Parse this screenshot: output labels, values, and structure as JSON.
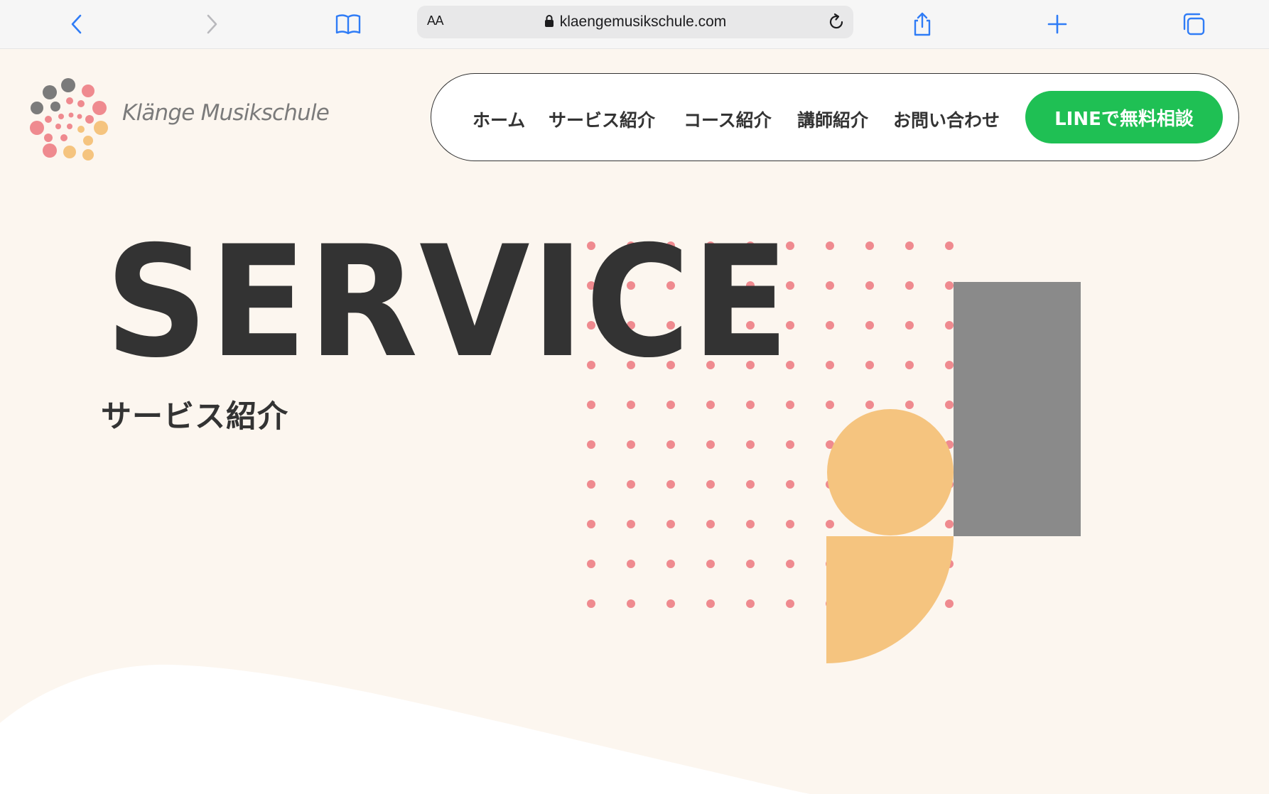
{
  "browser": {
    "reader_label": "AA",
    "url": "klaengemusikschule.com",
    "icons": [
      "back-chevron-icon",
      "forward-chevron-icon",
      "bookmarks-book-icon",
      "lock-icon",
      "reload-icon",
      "share-icon",
      "plus-icon",
      "tabs-icon"
    ]
  },
  "site": {
    "logo_text": "Klänge Musikschule",
    "nav": {
      "items": [
        {
          "label": "ホーム"
        },
        {
          "label": "サービス紹介"
        },
        {
          "label": "コース紹介"
        },
        {
          "label": "講師紹介"
        },
        {
          "label": "お問い合わせ"
        }
      ],
      "cta_label": "LINEで無料相談"
    }
  },
  "hero": {
    "title": "SERVICE",
    "subtitle": "サービス紹介"
  },
  "colors": {
    "page_bg": "#fcf6ef",
    "text": "#333333",
    "line_green": "#1fc054",
    "dot_pink": "#ef8a8f",
    "shape_orange": "#f5c47f",
    "shape_gray": "#8a8a8a"
  }
}
